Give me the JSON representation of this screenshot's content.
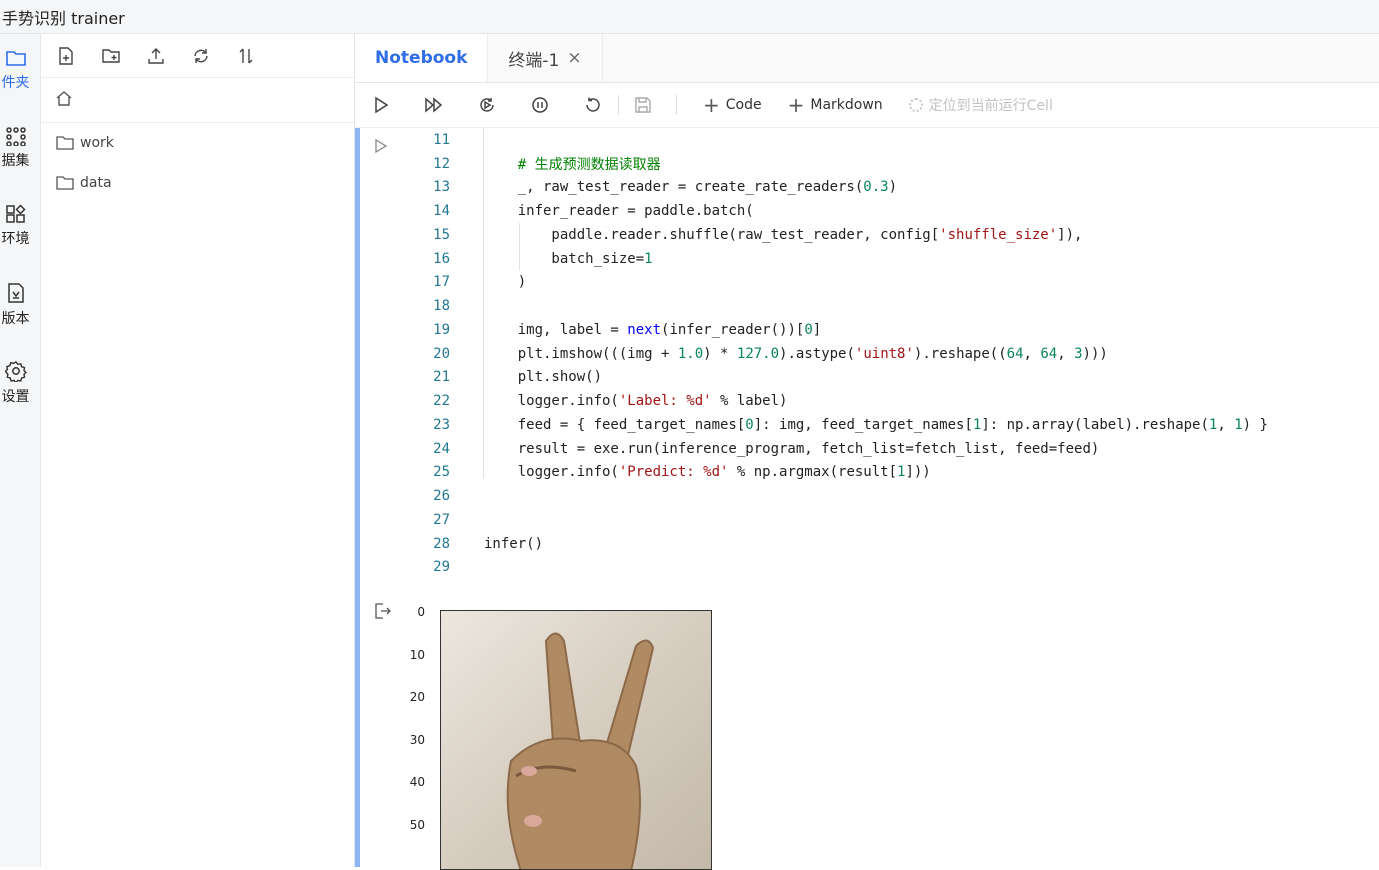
{
  "window": {
    "title": "手势识别 trainer"
  },
  "rail": {
    "items": [
      {
        "label": "件夹",
        "icon": "folder-icon",
        "active": true
      },
      {
        "label": "据集",
        "icon": "dataset-icon",
        "active": false
      },
      {
        "label": "环境",
        "icon": "environment-icon",
        "active": false
      },
      {
        "label": "版本",
        "icon": "version-icon",
        "active": false
      },
      {
        "label": "设置",
        "icon": "settings-icon",
        "active": false
      }
    ]
  },
  "file_panel": {
    "toolbar": [
      "new-file-icon",
      "new-folder-icon",
      "upload-icon",
      "refresh-icon",
      "sort-icon"
    ],
    "home_icon": "home-icon",
    "entries": [
      {
        "name": "work",
        "icon": "folder-icon"
      },
      {
        "name": "data",
        "icon": "folder-icon"
      }
    ]
  },
  "tabs": [
    {
      "label": "Notebook",
      "active": true,
      "closable": false
    },
    {
      "label": "终端-1",
      "active": false,
      "closable": true
    }
  ],
  "notebook_toolbar": {
    "icons": [
      "run-icon",
      "run-all-icon",
      "restart-run-icon",
      "interrupt-icon",
      "restart-icon",
      "save-icon"
    ],
    "add_code": "Code",
    "add_markdown": "Markdown",
    "locate": "定位到当前运行Cell"
  },
  "code_lines": [
    {
      "n": "11",
      "text": ""
    },
    {
      "n": "12",
      "text": "    # 生成预测数据读取器"
    },
    {
      "n": "13",
      "text": "    _, raw_test_reader = create_rate_readers(0.3)"
    },
    {
      "n": "14",
      "text": "    infer_reader = paddle.batch("
    },
    {
      "n": "15",
      "text": "        paddle.reader.shuffle(raw_test_reader, config['shuffle_size']),"
    },
    {
      "n": "16",
      "text": "        batch_size=1"
    },
    {
      "n": "17",
      "text": "    )"
    },
    {
      "n": "18",
      "text": ""
    },
    {
      "n": "19",
      "text": "    img, label = next(infer_reader())[0]"
    },
    {
      "n": "20",
      "text": "    plt.imshow(((img + 1.0) * 127.0).astype('uint8').reshape((64, 64, 3)))"
    },
    {
      "n": "21",
      "text": "    plt.show()"
    },
    {
      "n": "22",
      "text": "    logger.info('Label: %d' % label)"
    },
    {
      "n": "23",
      "text": "    feed = { feed_target_names[0]: img, feed_target_names[1]: np.array(label).reshape(1, 1) }"
    },
    {
      "n": "24",
      "text": "    result = exe.run(inference_program, fetch_list=fetch_list, feed=feed)"
    },
    {
      "n": "25",
      "text": "    logger.info('Predict: %d' % np.argmax(result[1]))"
    },
    {
      "n": "26",
      "text": ""
    },
    {
      "n": "27",
      "text": ""
    },
    {
      "n": "28",
      "text": "infer()"
    },
    {
      "n": "29",
      "text": ""
    }
  ],
  "output": {
    "icon": "output-icon",
    "plot_yticks": [
      "0",
      "10",
      "20",
      "30",
      "40",
      "50"
    ]
  }
}
